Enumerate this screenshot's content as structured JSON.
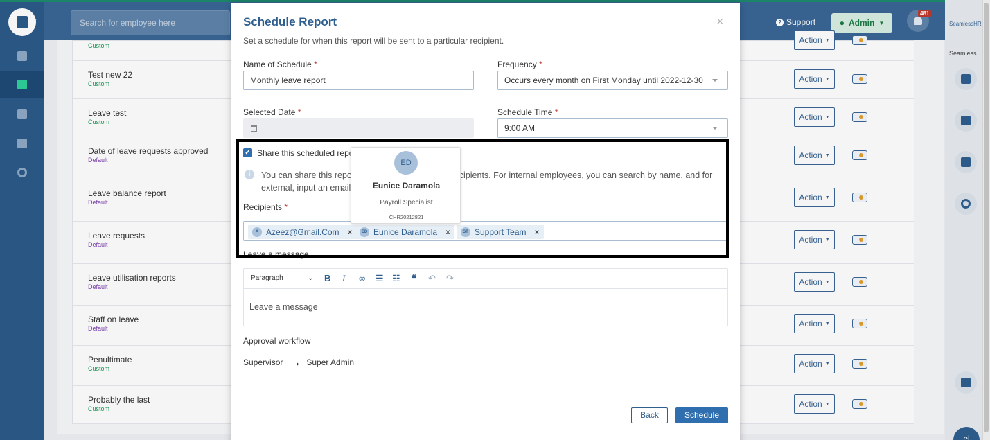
{
  "topbar": {
    "search_placeholder": "Search for employee here",
    "support_label": "Support",
    "admin_label": "Admin",
    "notification_count": "481"
  },
  "right_rail": {
    "brand": "SeamlessHR",
    "brand_short": "Seamless...",
    "avatar_initials": "el"
  },
  "reports": [
    {
      "name": "",
      "type": "Custom"
    },
    {
      "name": "Test new 22",
      "type": "Custom"
    },
    {
      "name": "Leave test",
      "type": "Custom"
    },
    {
      "name": "Date of leave requests approved",
      "type": "Default"
    },
    {
      "name": "Leave balance report",
      "type": "Default"
    },
    {
      "name": "Leave requests",
      "type": "Default"
    },
    {
      "name": "Leave utilisation reports",
      "type": "Default"
    },
    {
      "name": "Staff on leave",
      "type": "Default"
    },
    {
      "name": "Penultimate",
      "type": "Custom"
    },
    {
      "name": "Probably the last",
      "type": "Custom"
    }
  ],
  "action_label": "Action",
  "modal": {
    "title": "Schedule Report",
    "subtitle": "Set a schedule for when this report will be sent to a particular recipient.",
    "close": "×",
    "name_label": "Name of Schedule",
    "name_value": "Monthly leave report",
    "frequency_label": "Frequency",
    "frequency_value": "Occurs every month on First Monday until 2022-12-30",
    "date_label": "Selected Date",
    "time_label": "Schedule Time",
    "time_value": "9:00 AM",
    "required_mark": "*",
    "share_label": "Share this scheduled report",
    "info_text": "You can share this report with internal or external recipients. For internal employees, you can search by name, and for external, input an email.",
    "recipients_label": "Recipients",
    "recipients": [
      {
        "initials": "A",
        "label": "Azeez@Gmail.Com"
      },
      {
        "initials": "ED",
        "label": "Eunice Daramola"
      },
      {
        "initials": "ST",
        "label": "Support Team"
      }
    ],
    "message_label": "Leave a message",
    "editor_paragraph": "Paragraph",
    "editor_placeholder": "Leave a message",
    "approval_label": "Approval workflow",
    "flow_from": "Supervisor",
    "flow_to": "Super Admin",
    "back_label": "Back",
    "schedule_label": "Schedule"
  },
  "popover": {
    "initials": "ED",
    "name": "Eunice Daramola",
    "role": "Payroll Specialist",
    "id": "CHR20212821"
  },
  "colors": {
    "primary": "#2f5f8f",
    "sidebar": "#2c5a8a",
    "custom_tag": "#1d9a5c",
    "default_tag": "#7b3fb0"
  }
}
